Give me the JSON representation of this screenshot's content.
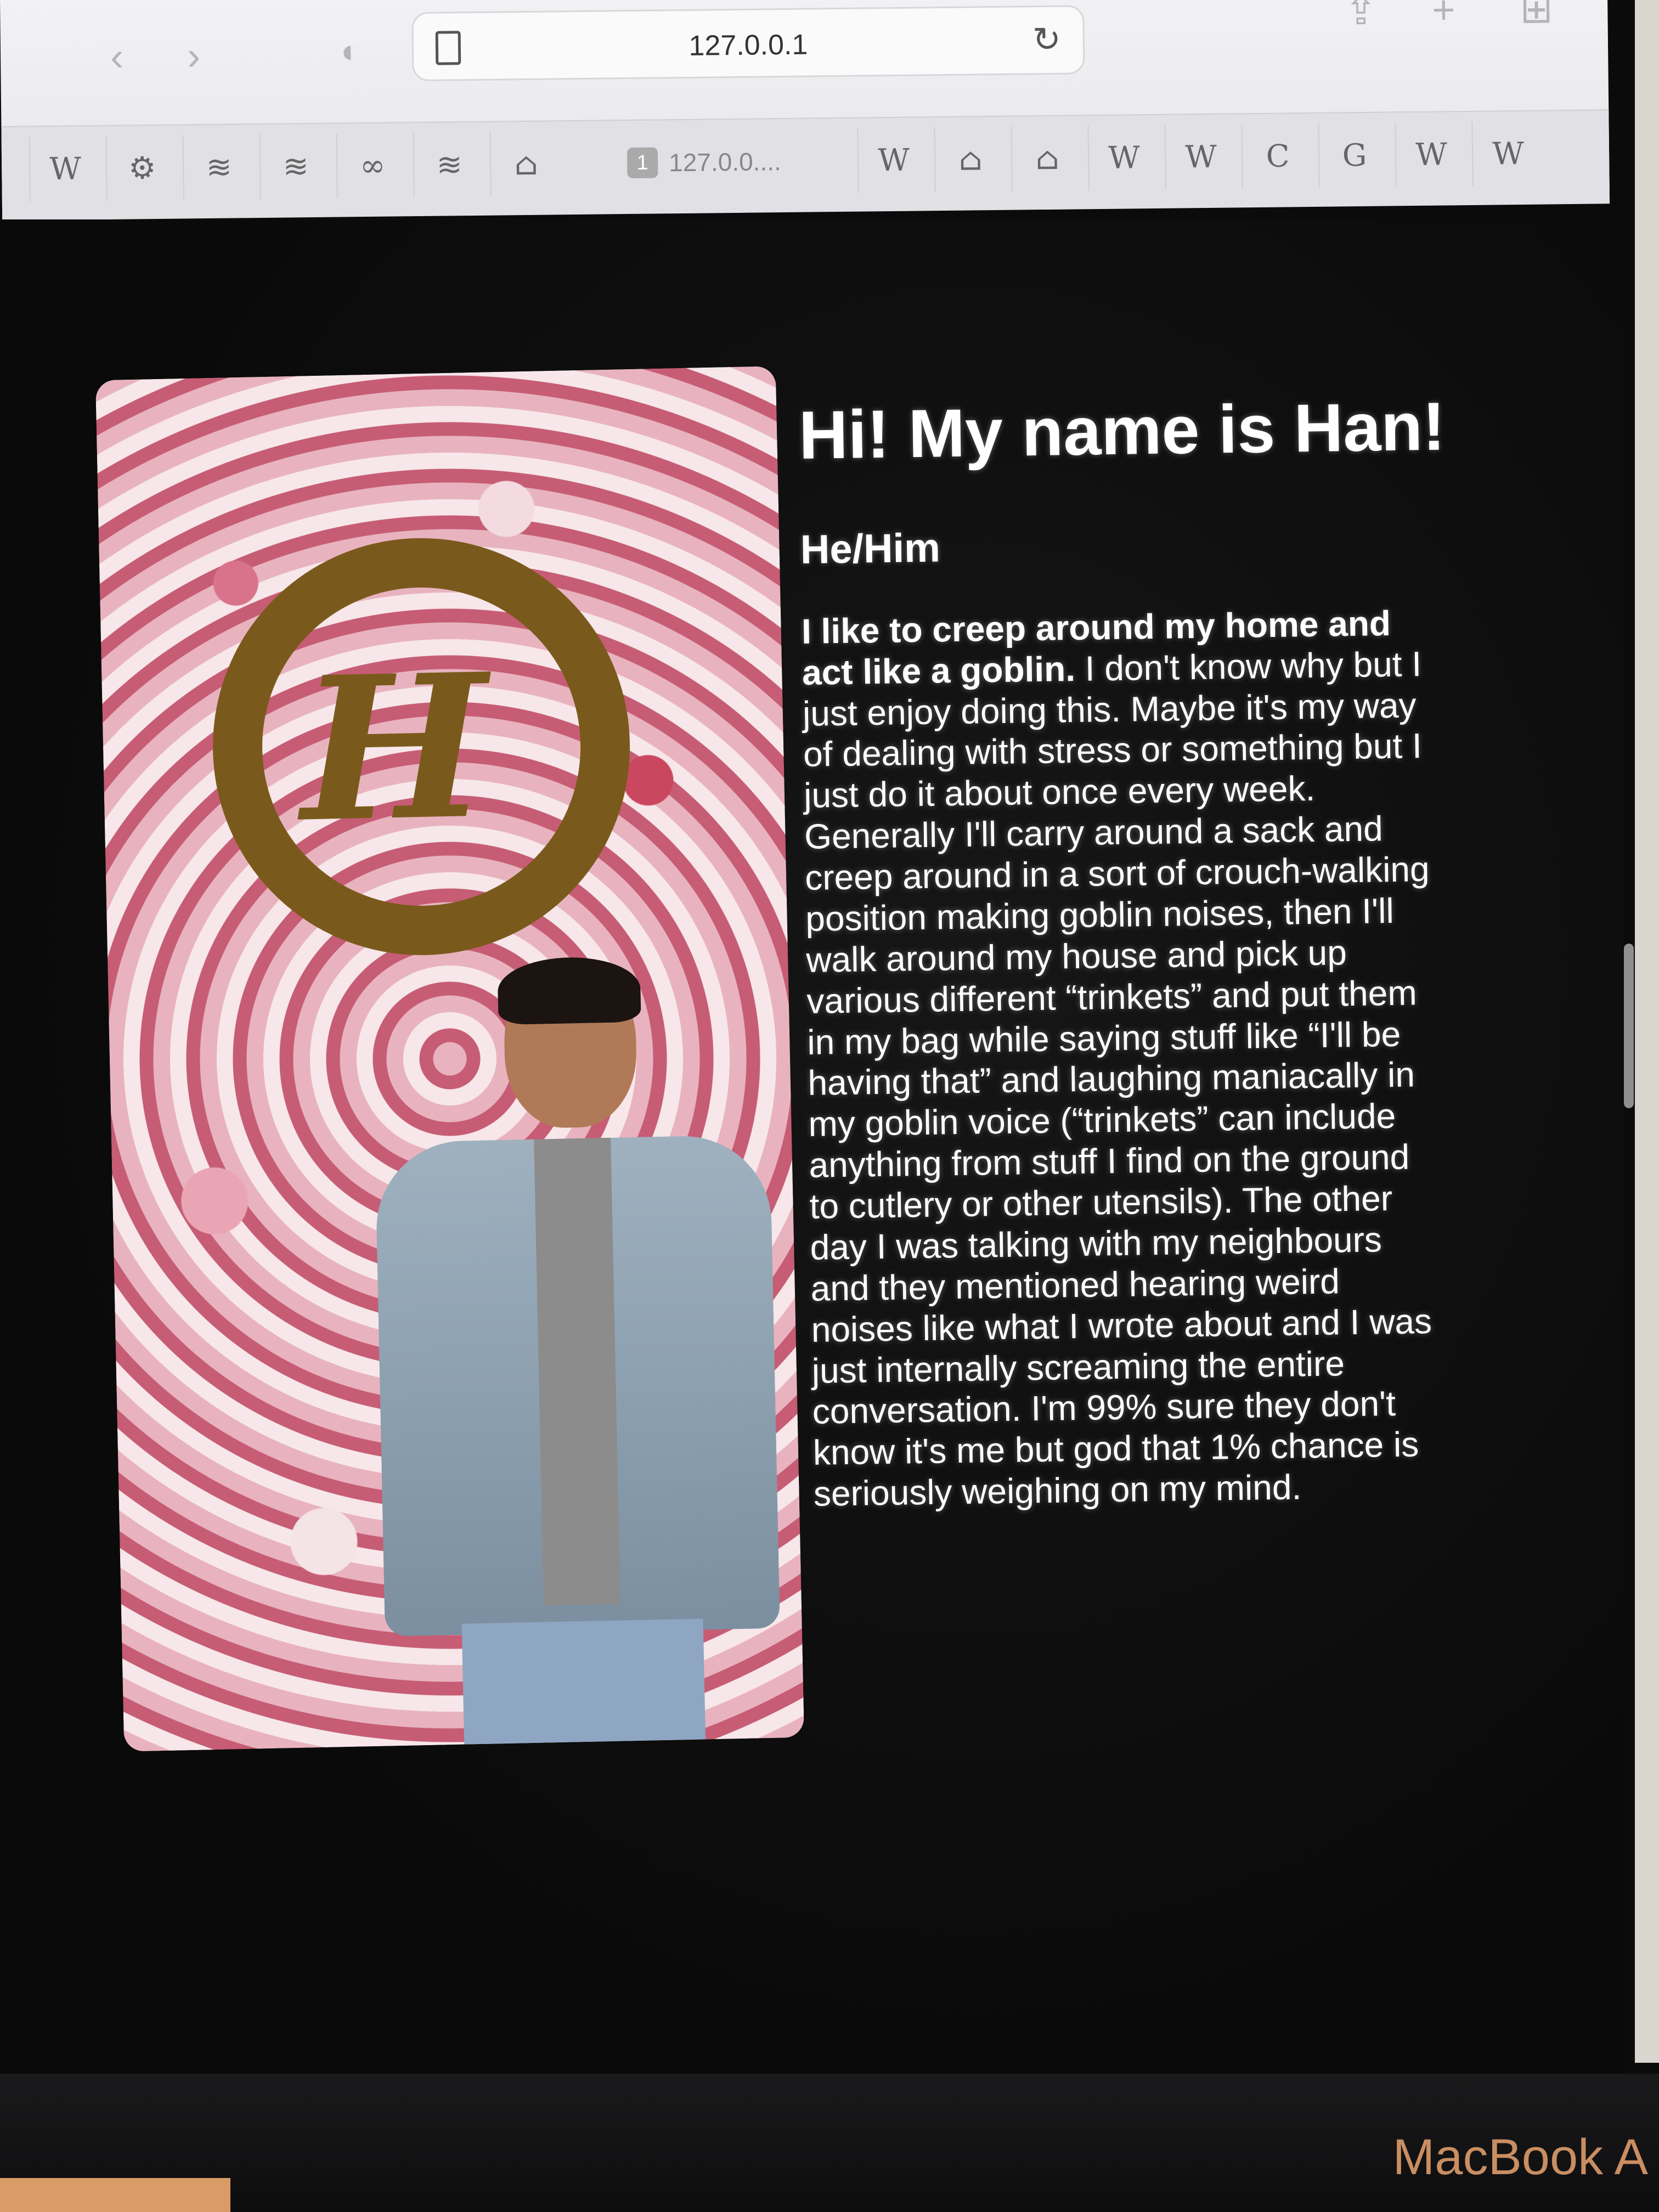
{
  "browser": {
    "url": "127.0.0.1",
    "active_tab": {
      "badge": "1",
      "label": "127.0.0...."
    },
    "nav": {
      "back": "‹",
      "forward": "›",
      "reload": "↻",
      "share": "⇪",
      "new_tab": "+",
      "tabs_overview": "⊞"
    },
    "tabs": [
      "W",
      "⚙",
      "≋",
      "≋",
      "∞",
      "≋",
      "⌂",
      "W",
      "⌂",
      "⌂",
      "W",
      "W",
      "C",
      "G",
      "W",
      "W"
    ]
  },
  "profile": {
    "heading": "Hi! My name is Han!",
    "pronouns": "He/Him",
    "bio_lead": "I like to creep around my home and act like a goblin.",
    "bio_rest": " I don't know why but I just enjoy doing this. Maybe it's my way of dealing with stress or something but I just do it about once every week. Generally I'll carry around a sack and creep around in a sort of crouch-walking position making goblin noises, then I'll walk around my house and pick up various different “trinkets” and put them in my bag while saying stuff like “I'll be having that” and laughing maniacally in my goblin voice (“trinkets” can include anything from stuff I find on the ground to cutlery or other utensils). The other day I was talking with my neighbours and they mentioned hearing weird noises like what I wrote about and I was just internally screaming the entire conversation. I'm 99% sure they don't know it's me but god that 1% chance is seriously weighing on my mind."
  },
  "device": {
    "brand": "MacBook A"
  }
}
